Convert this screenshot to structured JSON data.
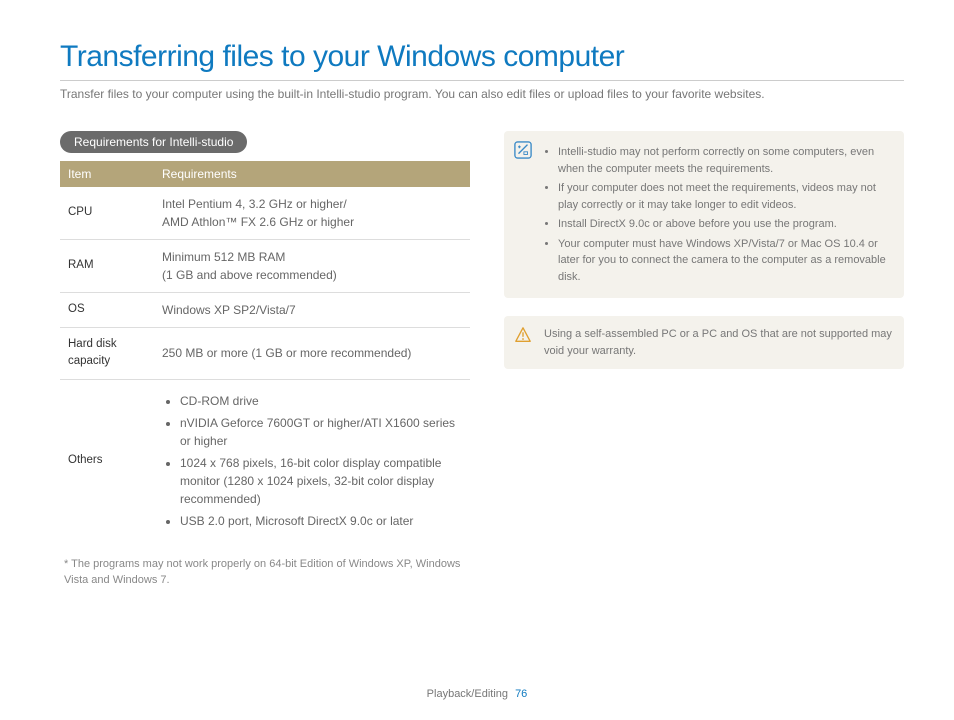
{
  "title": "Transferring files to your Windows computer",
  "intro": "Transfer files to your computer using the built-in Intelli-studio program. You can also edit files or upload files to your favorite websites.",
  "section_label": "Requirements for Intelli-studio",
  "table": {
    "headers": {
      "item": "Item",
      "req": "Requirements"
    },
    "rows": {
      "cpu": {
        "item": "CPU",
        "req": "Intel Pentium 4, 3.2 GHz or higher/\nAMD Athlon™ FX 2.6 GHz or higher"
      },
      "ram": {
        "item": "RAM",
        "req": "Minimum 512 MB RAM\n(1 GB and above recommended)"
      },
      "os": {
        "item": "OS",
        "req": "Windows XP SP2/Vista/7"
      },
      "hdd": {
        "item": "Hard disk capacity",
        "req": "250 MB or more (1 GB or more recommended)"
      },
      "others_label": "Others",
      "others": {
        "b1": "CD-ROM drive",
        "b2": "nVIDIA Geforce 7600GT or higher/ATI X1600 series or higher",
        "b3": "1024 x 768 pixels, 16-bit color display compatible monitor (1280 x 1024 pixels, 32-bit color display recommended)",
        "b4": "USB 2.0 port, Microsoft DirectX 9.0c or later"
      }
    }
  },
  "footnote": "* The programs may not work properly on 64-bit Edition of Windows XP, Windows Vista and Windows 7.",
  "note": {
    "b1": "Intelli-studio may not perform correctly on some computers, even when the computer meets the requirements.",
    "b2": "If your computer does not meet the requirements, videos may not play correctly or it may take longer to edit videos.",
    "b3": "Install DirectX 9.0c or above before you use the program.",
    "b4": "Your computer must have Windows XP/Vista/7 or Mac OS 10.4 or later for you to connect the camera to the computer as a removable disk."
  },
  "warning": "Using a self-assembled PC or a PC and OS that are not supported may void your warranty.",
  "footer": {
    "section": "Playback/Editing",
    "page": "76"
  }
}
